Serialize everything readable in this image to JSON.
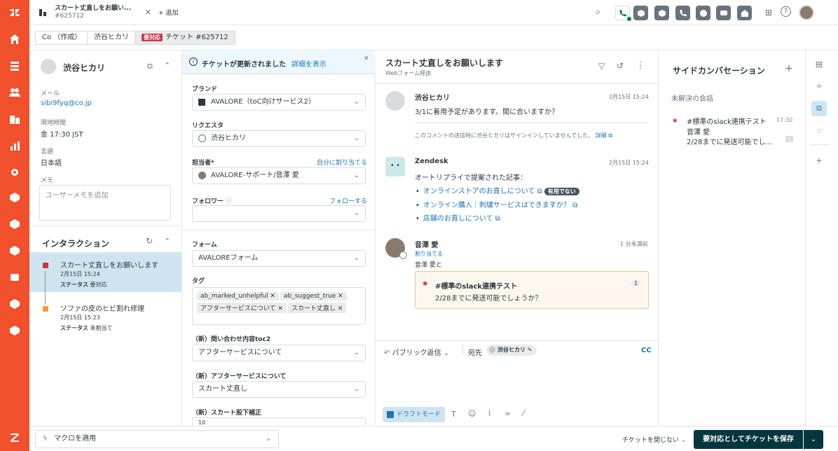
{
  "rail": {
    "items": [
      "home-icon",
      "views-icon",
      "customers-icon",
      "organizations-icon",
      "reporting-icon",
      "settings-icon",
      "app-icon",
      "app-icon",
      "app-icon",
      "app-icon",
      "app-icon",
      "app-icon"
    ]
  },
  "topbar": {
    "tab_title": "スカート丈直しをお願い...",
    "tab_subtitle": "#625712",
    "add_tab": "+ 追加"
  },
  "context": {
    "crumb_org": "Co （作成）",
    "crumb_user": "渋谷ヒカリ",
    "crumb_badge": "要対応",
    "crumb_ticket": "チケット #625712"
  },
  "user": {
    "name": "渋谷ヒカリ",
    "email_label": "メール",
    "email": "sibi9fyq@co.jp",
    "localtime_label": "現地時間",
    "localtime": "金 17:30 JST",
    "language_label": "言語",
    "language": "日本語",
    "notes_label": "メモ",
    "notes_placeholder": "ユーザーメモを追加"
  },
  "interactions": {
    "title": "インタラクション",
    "items": [
      {
        "title": "スカート丈直しをお願いします",
        "date": "2月15日 15:24",
        "status_label": "ステータス",
        "status": "要対応"
      },
      {
        "title": "ソファの皮のヒビ割れ修理",
        "date": "2月15日 15:23",
        "status_label": "ステータス",
        "status": "未割当て"
      }
    ]
  },
  "properties": {
    "banner_text": "チケットが更新されました",
    "banner_link": "詳細を表示",
    "brand_label": "ブランド",
    "brand": "AVALORE（toC向けサービス2）",
    "requester_label": "リクエスタ",
    "requester": "渋谷ヒカリ",
    "assignee_label": "担当者*",
    "assign_self": "自分に割り当てる",
    "assignee": "AVALORE-サポート/音澤 愛",
    "follower_label": "フォロワー",
    "follow_link": "フォローする",
    "form_label": "フォーム",
    "form": "AVALOREフォーム",
    "tags_label": "タグ",
    "tags": [
      "ab_marked_unhelpful",
      "ab_suggest_true",
      "アフターサービスについて",
      "スカート丈直し"
    ],
    "field1_label": "（新）問い合わせ内容toc2",
    "field1": "アフターサービスについて",
    "field2_label": "（新）アフターサービスについて",
    "field2": "スカート丈直し",
    "field3_label": "（新）スカート股下補正",
    "field3": "10"
  },
  "conversation": {
    "title": "スカート丈直しをお願いします",
    "subtitle": "Webフォーム経由",
    "messages": [
      {
        "author": "渋谷ヒカリ",
        "time": "2月15日 15:24",
        "text": "3/1に着用予定があります。間に合いますか？",
        "note": "このコメントの送信時に渋谷ヒカリはサインインしていませんでした。",
        "note_link": "詳細"
      },
      {
        "author": "Zendesk",
        "time": "2月15日 15:24",
        "text": "オートリプライで提案された記事：",
        "articles": [
          "オンラインストアのお直しについて",
          "オンライン購入｜刺繍サービスはできますか？",
          "店舗のお直しについて"
        ],
        "unhelpful_badge": "有用でない"
      },
      {
        "author": "音澤 愛",
        "time": "1 分未満前",
        "action": "割り当てる",
        "action_sub": "音澤 愛と",
        "slack_channel": "#標準のslack連携テスト",
        "slack_count": "1",
        "slack_text": "2/28までに発送可能でしょうか？"
      }
    ],
    "composer": {
      "mode": "パブリック返信",
      "to_label": "宛先",
      "to": "渋谷ヒカリ",
      "cc": "CC",
      "draft_mode": "ドラフトモード"
    }
  },
  "side_conversations": {
    "title": "サイドカンバセーション",
    "section": "未解決の会話",
    "items": [
      {
        "channel": "#標準のslack連携テスト",
        "time": "17:30",
        "author": "音澤 愛",
        "preview": "2/28までに発送可能でし...",
        "count": "1"
      }
    ]
  },
  "footer": {
    "macro": "マクロを適用",
    "close_label": "チケットを閉じない",
    "save_label": "要対応としてチケットを保存"
  },
  "colors": {
    "rail": "#f0502b",
    "primary": "#03363d",
    "link": "#1f73b7",
    "urgent": "#cc3340"
  }
}
